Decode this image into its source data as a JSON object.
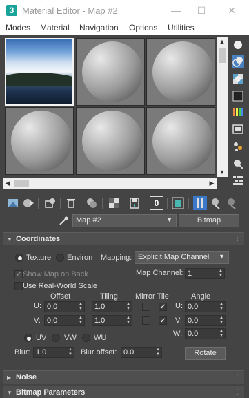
{
  "window": {
    "app_icon": "3",
    "title": "Material Editor - Map #2",
    "minimize": "—",
    "maximize": "☐",
    "close": "✕"
  },
  "menu": {
    "items": [
      "Modes",
      "Material",
      "Navigation",
      "Options",
      "Utilities"
    ]
  },
  "sample_slots": [
    {
      "kind": "bitmap-photo",
      "active": true
    },
    {
      "kind": "sphere",
      "active": false
    },
    {
      "kind": "sphere",
      "active": false
    },
    {
      "kind": "sphere",
      "active": false
    },
    {
      "kind": "sphere",
      "active": false
    },
    {
      "kind": "sphere",
      "active": false
    }
  ],
  "scroll": {
    "up": "▲",
    "down": "▼",
    "left": "◀",
    "right": "▶"
  },
  "side_tools": [
    "sample-type-icon",
    "backlight-icon",
    "background-icon",
    "uv-tiling-icon",
    "video-color-check-icon",
    "make-preview-icon",
    "options-icon",
    "select-by-material-icon",
    "material-map-navigator-icon"
  ],
  "toolbar": {
    "buttons": [
      "get-material-icon",
      "put-to-scene-icon",
      "assign-to-selection-icon",
      "reset-map-icon",
      "make-copy-icon",
      "make-unique-icon",
      "put-to-library-icon",
      "material-id-channel-icon",
      "show-shaded-icon",
      "show-end-result-icon",
      "go-to-parent-icon",
      "go-forward-icon"
    ],
    "material_id": "0"
  },
  "name_row": {
    "map_name": "Map #2",
    "type_button": "Bitmap"
  },
  "coordinates": {
    "header": "Coordinates",
    "texture_label": "Texture",
    "environ_label": "Environ",
    "mapping_label": "Mapping:",
    "mapping_value": "Explicit Map Channel",
    "show_map_on_back": "Show Map on Back",
    "map_channel_label": "Map Channel:",
    "map_channel_value": "1",
    "use_real_world_scale": "Use Real-World Scale",
    "col_offset": "Offset",
    "col_tiling": "Tiling",
    "col_mirror_tile": "Mirror Tile",
    "col_angle": "Angle",
    "u_label": "U:",
    "v_label": "V:",
    "w_label": "W:",
    "u_offset": "0.0",
    "v_offset": "0.0",
    "u_tiling": "1.0",
    "v_tiling": "1.0",
    "u_angle": "0.0",
    "v_angle": "0.0",
    "w_angle": "0.0",
    "uv_label": "UV",
    "vw_label": "VW",
    "wu_label": "WU",
    "blur_label": "Blur:",
    "blur_value": "1.0",
    "blur_offset_label": "Blur offset:",
    "blur_offset_value": "0.0",
    "rotate_button": "Rotate"
  },
  "rollouts": {
    "noise": "Noise",
    "bitmap_parameters": "Bitmap Parameters"
  },
  "colors": {
    "panel": "#444444",
    "slot_active_border": "#f2f2f2",
    "accent": "#3c78c8"
  }
}
